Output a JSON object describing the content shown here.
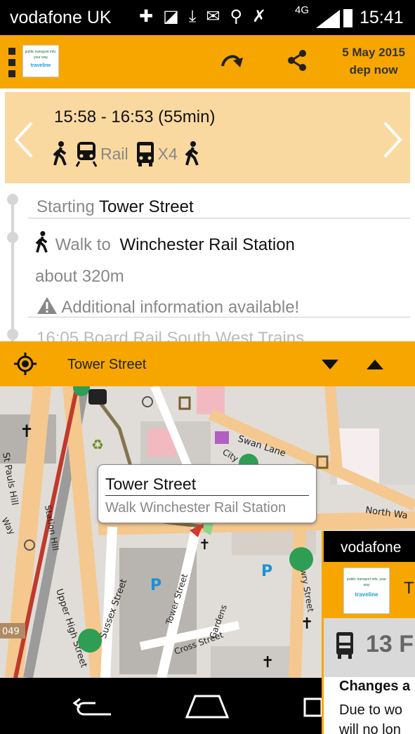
{
  "status_bar": {
    "carrier": "vodafone UK",
    "network": "4G",
    "time": "15:41"
  },
  "app_bar": {
    "logo_tagline": "public transport info, your way",
    "logo_brand": "traveline",
    "date": "5 May 2015",
    "departure": "dep now"
  },
  "journey": {
    "time_range": "15:58 - 16:53 (55min)",
    "modes": [
      {
        "icon": "walk-icon"
      },
      {
        "icon": "train-icon",
        "label": "Rail"
      },
      {
        "icon": "bus-icon",
        "label": "X4"
      },
      {
        "icon": "walk-icon"
      }
    ]
  },
  "steps": {
    "starting_label": "Starting",
    "starting_place": "Tower Street",
    "walk_label": "Walk to",
    "walk_destination": "Winchester Rail Station",
    "distance": "about 320m",
    "info": "Additional information available!",
    "next_partial": "16:05 Board  Rail South West Trains"
  },
  "location_bar": {
    "label": "Tower Street"
  },
  "map": {
    "street_labels": [
      "Swan Lane",
      "North Wa",
      "City",
      "Jewry Street",
      "Sussex Street",
      "Tower Street",
      "Cross Street",
      "Upper High Street",
      "St Pauls Hill",
      "Station Hill",
      "Gardens",
      "Way",
      "049"
    ],
    "popup_title": "Tower Street",
    "popup_subtitle": "Walk Winchester Rail Station"
  },
  "overlay": {
    "carrier": "vodafone",
    "title_initial": "T",
    "route_number": "13 F",
    "changes": "Changes a",
    "due": "Due to wo",
    "will": "will no lon"
  },
  "colors": {
    "accent": "#f7a600",
    "card": "#fad9a1",
    "route_line": "#c0392b",
    "walk_path": "#6b5a2e"
  }
}
